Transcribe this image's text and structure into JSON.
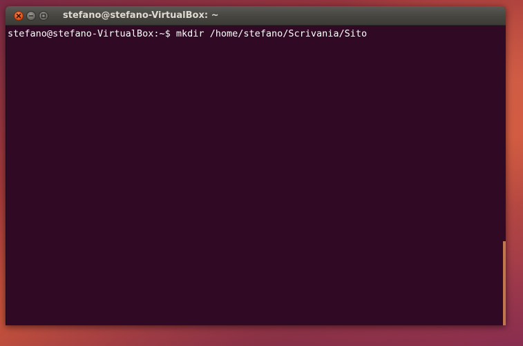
{
  "window": {
    "title": "stefano@stefano-VirtualBox: ~",
    "controls": [
      "close",
      "minimize",
      "maximize"
    ]
  },
  "terminal": {
    "prompt": "stefano@stefano-VirtualBox:~$ ",
    "command": "mkdir /home/stefano/Scrivania/Sito"
  },
  "colors": {
    "terminal_bg": "#300a24",
    "titlebar": "#3c3b37",
    "close_button": "#e2531c",
    "text": "#ffffff"
  },
  "icons": {
    "close": "close-icon",
    "minimize": "minimize-icon",
    "maximize": "maximize-icon"
  }
}
